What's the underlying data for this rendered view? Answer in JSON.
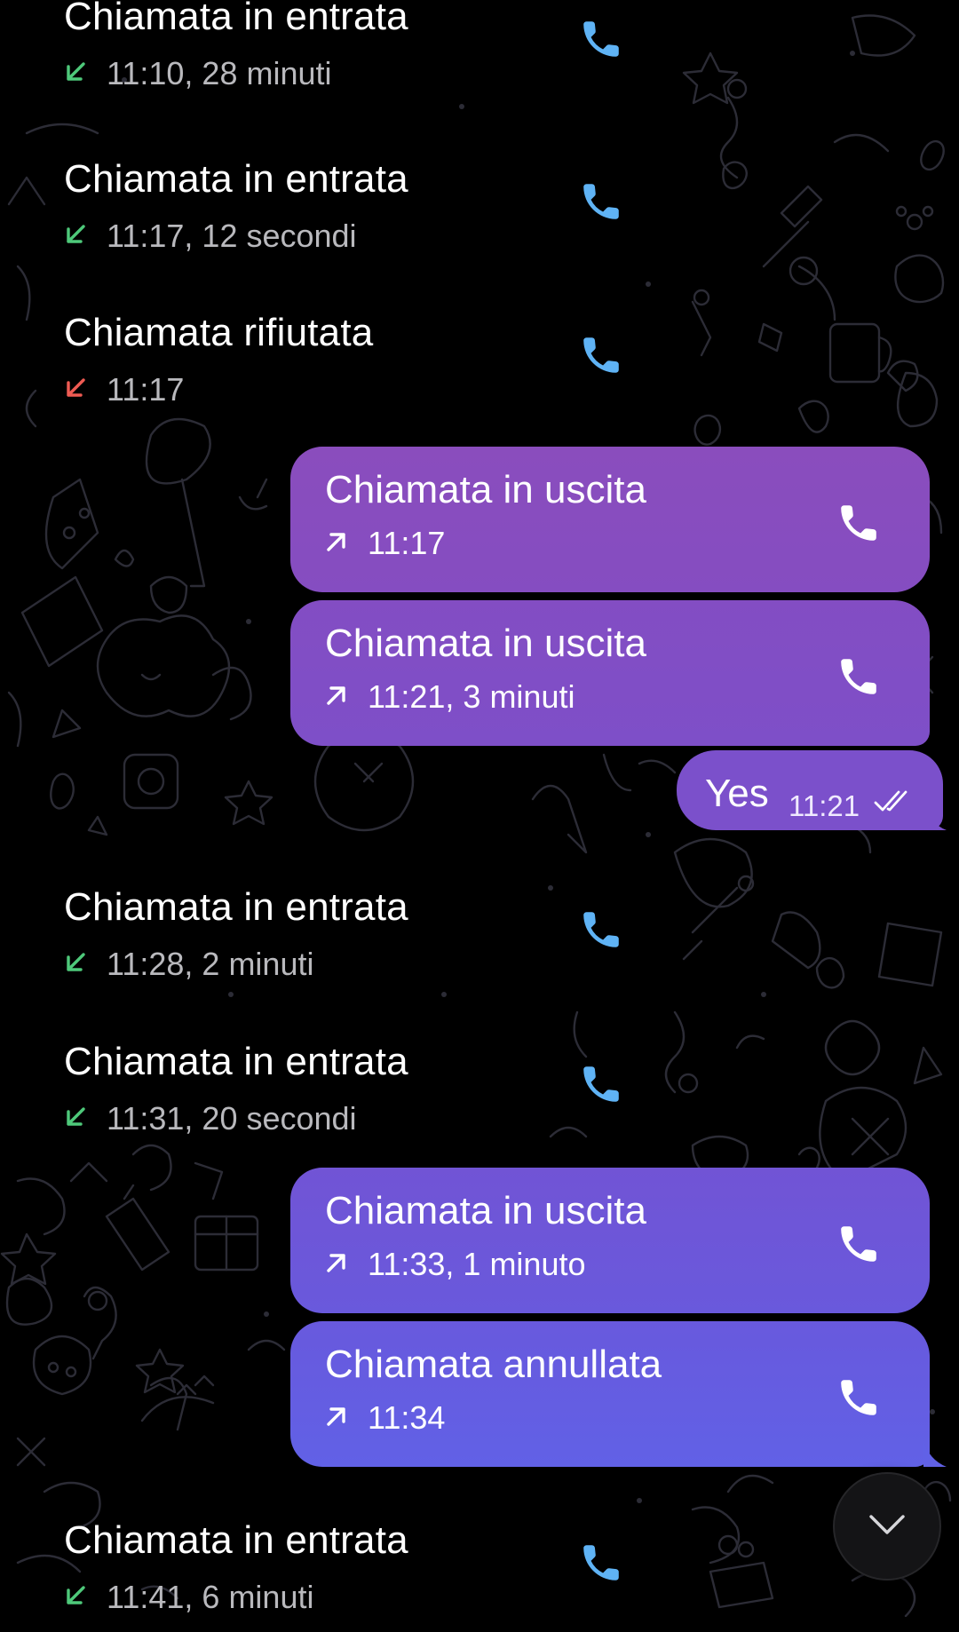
{
  "colors": {
    "background": "#000000",
    "incoming_arrow": "#4ec97a",
    "declined_arrow": "#ef5b53",
    "phone_icon_incoming": "#5fb3f5",
    "bubble_gradient_top": "#8a4dbd",
    "bubble_gradient_bottom": "#6161e6"
  },
  "messages": [
    {
      "kind": "call-in",
      "title": "Chiamata in entrata",
      "time": "11:10, 28 minuti",
      "arrow_icon": "incoming-arrow-icon",
      "status": "received"
    },
    {
      "kind": "call-in",
      "title": "Chiamata in entrata",
      "time": "11:17, 12 secondi",
      "arrow_icon": "incoming-arrow-icon",
      "status": "received"
    },
    {
      "kind": "call-in",
      "title": "Chiamata rifiutata",
      "time": "11:17",
      "arrow_icon": "declined-arrow-icon",
      "status": "declined"
    },
    {
      "kind": "call-out",
      "title": "Chiamata in uscita",
      "time": "11:17",
      "arrow_icon": "outgoing-arrow-icon"
    },
    {
      "kind": "call-out",
      "title": "Chiamata in uscita",
      "time": "11:21, 3 minuti",
      "arrow_icon": "outgoing-arrow-icon"
    },
    {
      "kind": "text-out",
      "text": "Yes",
      "time": "11:21",
      "read_icon": "double-check-icon"
    },
    {
      "kind": "call-in",
      "title": "Chiamata in entrata",
      "time": "11:28, 2 minuti",
      "arrow_icon": "incoming-arrow-icon",
      "status": "received"
    },
    {
      "kind": "call-in",
      "title": "Chiamata in entrata",
      "time": "11:31, 20 secondi",
      "arrow_icon": "incoming-arrow-icon",
      "status": "received"
    },
    {
      "kind": "call-out",
      "title": "Chiamata in uscita",
      "time": "11:33, 1 minuto",
      "arrow_icon": "outgoing-arrow-icon"
    },
    {
      "kind": "call-out",
      "title": "Chiamata annullata",
      "time": "11:34",
      "arrow_icon": "outgoing-arrow-icon"
    },
    {
      "kind": "call-in",
      "title": "Chiamata in entrata",
      "time": "11:41, 6 minuti",
      "arrow_icon": "incoming-arrow-icon",
      "status": "received"
    }
  ],
  "scroll_button": {
    "icon": "chevron-down-icon"
  }
}
